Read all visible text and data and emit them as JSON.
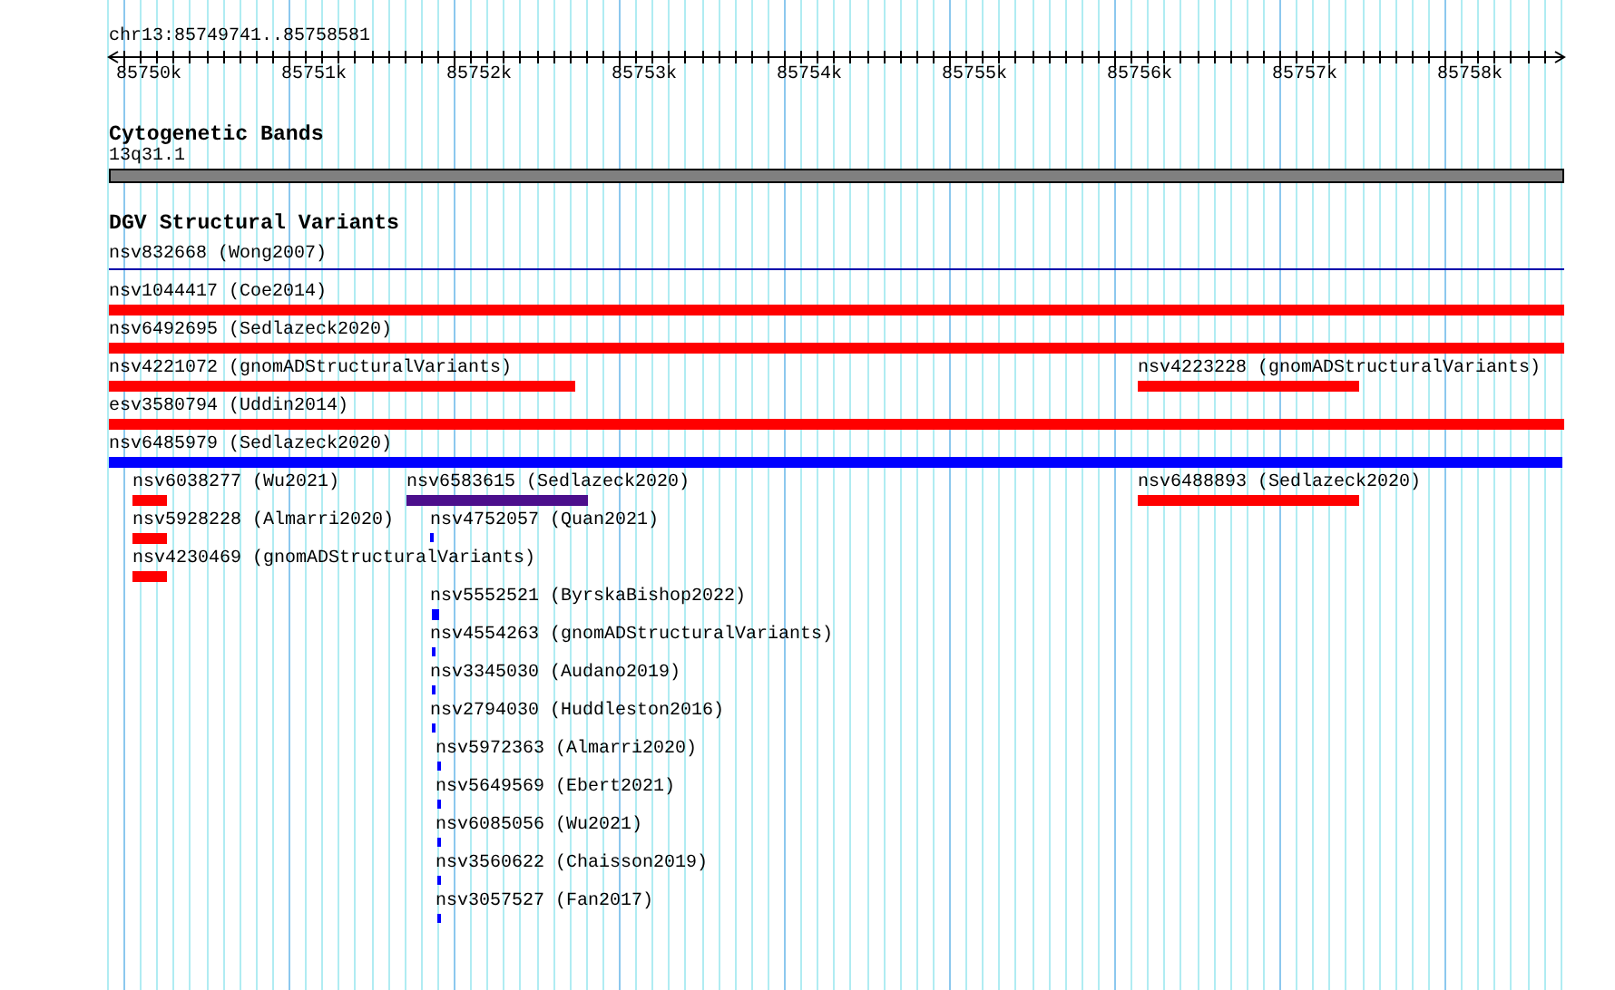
{
  "ruler": {
    "location": "chr13:85749741..85758581",
    "ticks": [
      "85750k",
      "85751k",
      "85752k",
      "85753k",
      "85754k",
      "85755k",
      "85756k",
      "85757k",
      "85758k"
    ]
  },
  "tracks": [
    {
      "title": "Cytogenetic Bands",
      "features": [
        {
          "label": "13q31.1",
          "kind": "band"
        }
      ]
    },
    {
      "title": "DGV Structural Variants",
      "features": [
        {
          "label": "nsv832668 (Wong2007)",
          "kind": "line",
          "color": "#0000aa"
        },
        {
          "label": "nsv1044417 (Coe2014)",
          "kind": "bar",
          "color": "#ff0000"
        },
        {
          "label": "nsv6492695 (Sedlazeck2020)",
          "kind": "bar",
          "color": "#ff0000"
        },
        {
          "label": "nsv4221072 (gnomADStructuralVariants)",
          "kind": "bar",
          "color": "#ff0000"
        },
        {
          "label": "nsv4223228 (gnomADStructuralVariants)",
          "kind": "bar",
          "color": "#ff0000"
        },
        {
          "label": "esv3580794 (Uddin2014)",
          "kind": "bar",
          "color": "#ff0000"
        },
        {
          "label": "nsv6485979 (Sedlazeck2020)",
          "kind": "bar",
          "color": "#0000ff"
        },
        {
          "label": "nsv6038277 (Wu2021)",
          "kind": "bar",
          "color": "#ff0000"
        },
        {
          "label": "nsv6583615 (Sedlazeck2020)",
          "kind": "bar",
          "color": "#4b0f8c"
        },
        {
          "label": "nsv6488893 (Sedlazeck2020)",
          "kind": "bar",
          "color": "#ff0000"
        },
        {
          "label": "nsv5928228 (Almarri2020)",
          "kind": "bar",
          "color": "#ff0000"
        },
        {
          "label": "nsv4752057 (Quan2021)",
          "kind": "bar",
          "color": "#0000ff"
        },
        {
          "label": "nsv4230469 (gnomADStructuralVariants)",
          "kind": "bar",
          "color": "#ff0000"
        },
        {
          "label": "nsv5552521 (ByrskaBishop2022)",
          "kind": "bar",
          "color": "#0000ff"
        },
        {
          "label": "nsv4554263 (gnomADStructuralVariants)",
          "kind": "bar",
          "color": "#0000ff"
        },
        {
          "label": "nsv3345030 (Audano2019)",
          "kind": "bar",
          "color": "#0000ff"
        },
        {
          "label": "nsv2794030 (Huddleston2016)",
          "kind": "bar",
          "color": "#0000ff"
        },
        {
          "label": "nsv5972363 (Almarri2020)",
          "kind": "bar",
          "color": "#0000ff"
        },
        {
          "label": "nsv5649569 (Ebert2021)",
          "kind": "bar",
          "color": "#0000ff"
        },
        {
          "label": "nsv6085056 (Wu2021)",
          "kind": "bar",
          "color": "#0000ff"
        },
        {
          "label": "nsv3560622 (Chaisson2019)",
          "kind": "bar",
          "color": "#0000ff"
        },
        {
          "label": "nsv3057527 (Fan2017)",
          "kind": "bar",
          "color": "#0000ff"
        }
      ]
    }
  ]
}
